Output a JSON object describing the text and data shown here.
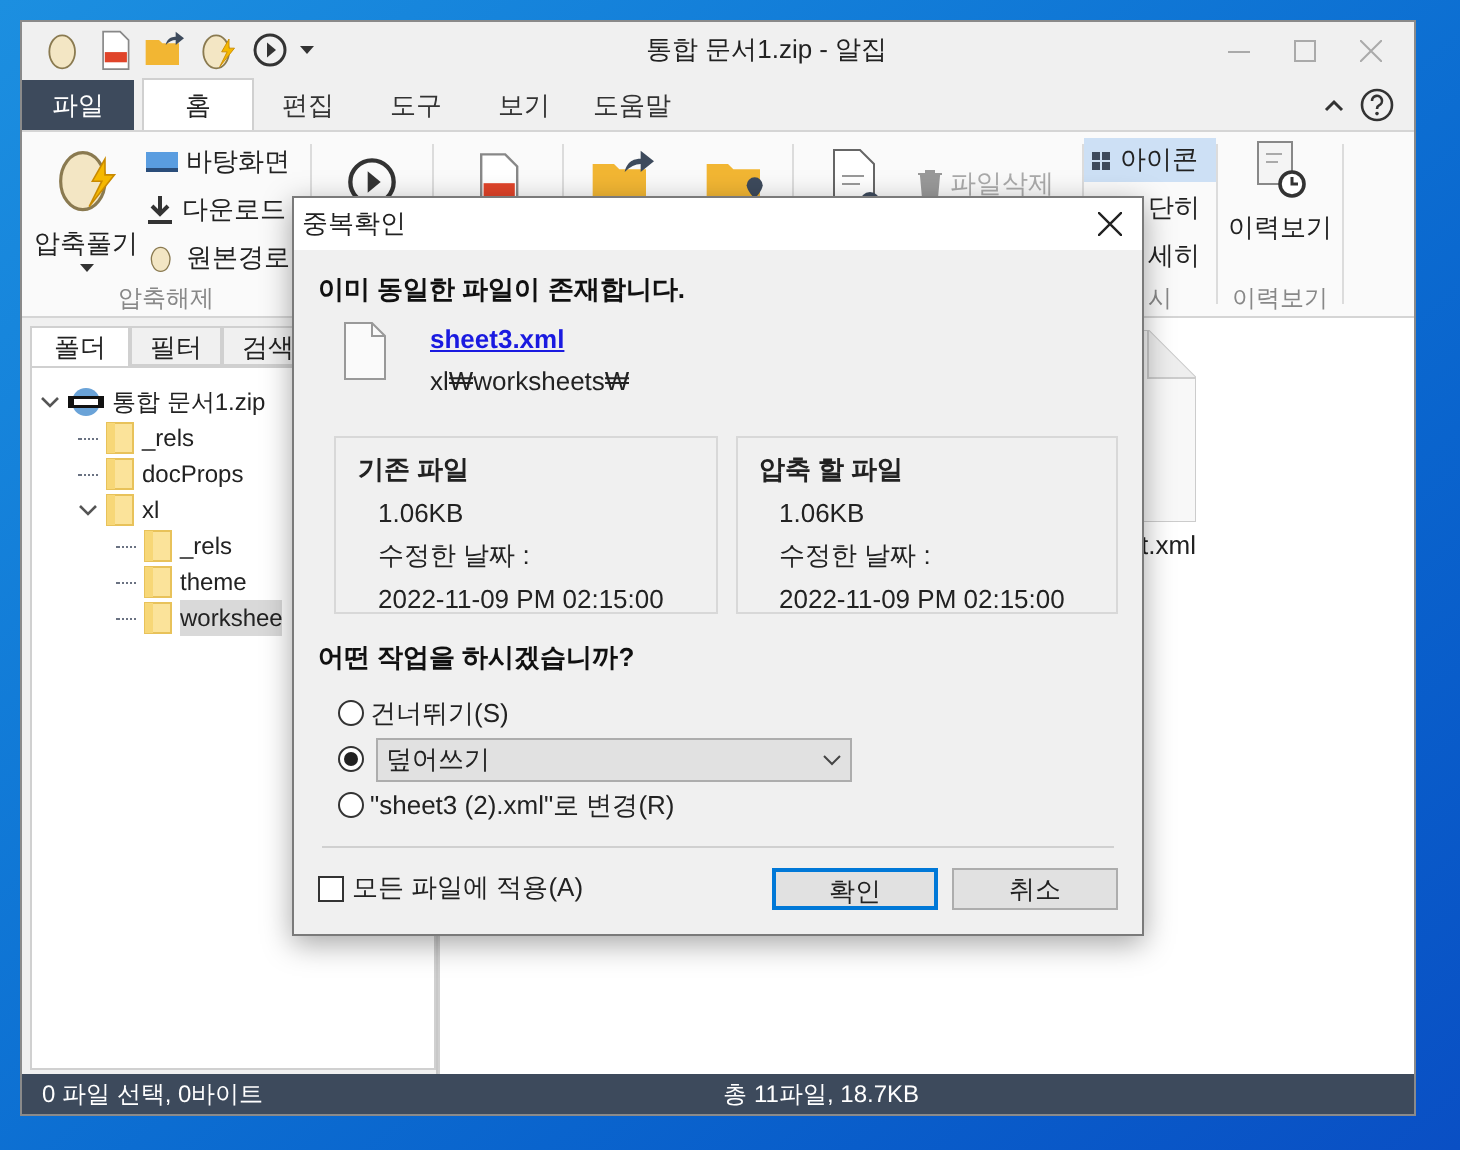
{
  "window": {
    "title": "통합 문서1.zip - 알집"
  },
  "ribbon_tabs": [
    {
      "label": "파일",
      "kind": "file",
      "selected": false
    },
    {
      "label": "홈",
      "kind": "tab",
      "selected": true
    },
    {
      "label": "편집",
      "kind": "tab",
      "selected": false
    },
    {
      "label": "도구",
      "kind": "tab",
      "selected": false
    },
    {
      "label": "보기",
      "kind": "tab",
      "selected": false
    },
    {
      "label": "도움말",
      "kind": "tab",
      "selected": false
    }
  ],
  "ribbon": {
    "extract": {
      "large_button": "압축풀기",
      "small_buttons": [
        "바탕화면",
        "다운로드",
        "원본경로"
      ],
      "group_label": "압축해제"
    },
    "delete_button": {
      "label": "파일삭제",
      "disabled": true
    },
    "view_options": [
      {
        "label": "아이콘",
        "selected": true
      },
      {
        "label": "단히",
        "selected": false
      },
      {
        "label": "세히",
        "selected": false
      }
    ],
    "view_group_label": "시",
    "history": {
      "button": "이력보기",
      "group_label": "이력보기"
    }
  },
  "side_tabs": [
    {
      "label": "폴더",
      "selected": true
    },
    {
      "label": "필터",
      "selected": false
    },
    {
      "label": "검색",
      "selected": false
    }
  ],
  "tree": [
    {
      "label": "통합 문서1.zip",
      "kind": "archive",
      "expanded": true,
      "selected": false,
      "children": [
        {
          "label": "_rels",
          "kind": "folder",
          "selected": false
        },
        {
          "label": "docProps",
          "kind": "folder",
          "selected": false
        },
        {
          "label": "xl",
          "kind": "folder",
          "expanded": true,
          "selected": false,
          "children": [
            {
              "label": "_rels",
              "kind": "folder",
              "selected": false
            },
            {
              "label": "theme",
              "kind": "folder",
              "selected": false
            },
            {
              "label": "workshee",
              "kind": "folder",
              "selected": true
            }
          ]
        }
      ]
    }
  ],
  "file_tiles": [
    {
      "label": "t.xml"
    }
  ],
  "status_bar": {
    "selection": "0 파일 선택, 0바이트",
    "total": "총 11파일, 18.7KB"
  },
  "dialog": {
    "title": "중복확인",
    "message": "이미 동일한 파일이 존재합니다.",
    "file_name": "sheet3.xml",
    "file_path": "xl₩worksheets₩",
    "files": [
      {
        "heading": "기존 파일",
        "size": "1.06KB",
        "modified_label": "수정한 날짜 :",
        "modified": "2022-11-09 PM 02:15:00"
      },
      {
        "heading": "압축 할 파일",
        "size": "1.06KB",
        "modified_label": "수정한 날짜 :",
        "modified": "2022-11-09 PM 02:15:00"
      }
    ],
    "question": "어떤 작업을 하시겠습니까?",
    "options": [
      {
        "kind": "radio",
        "label": "건너뛰기(S)",
        "selected": false
      },
      {
        "kind": "select",
        "value": "덮어쓰기",
        "selected": true
      },
      {
        "kind": "radio",
        "label": "\"sheet3 (2).xml\"로 변경(R)",
        "selected": false
      }
    ],
    "apply_all": {
      "label": "모든 파일에 적용(A)",
      "checked": false
    },
    "buttons": [
      {
        "label": "확인",
        "kind": "default"
      },
      {
        "label": "취소",
        "kind": "normal"
      }
    ]
  }
}
